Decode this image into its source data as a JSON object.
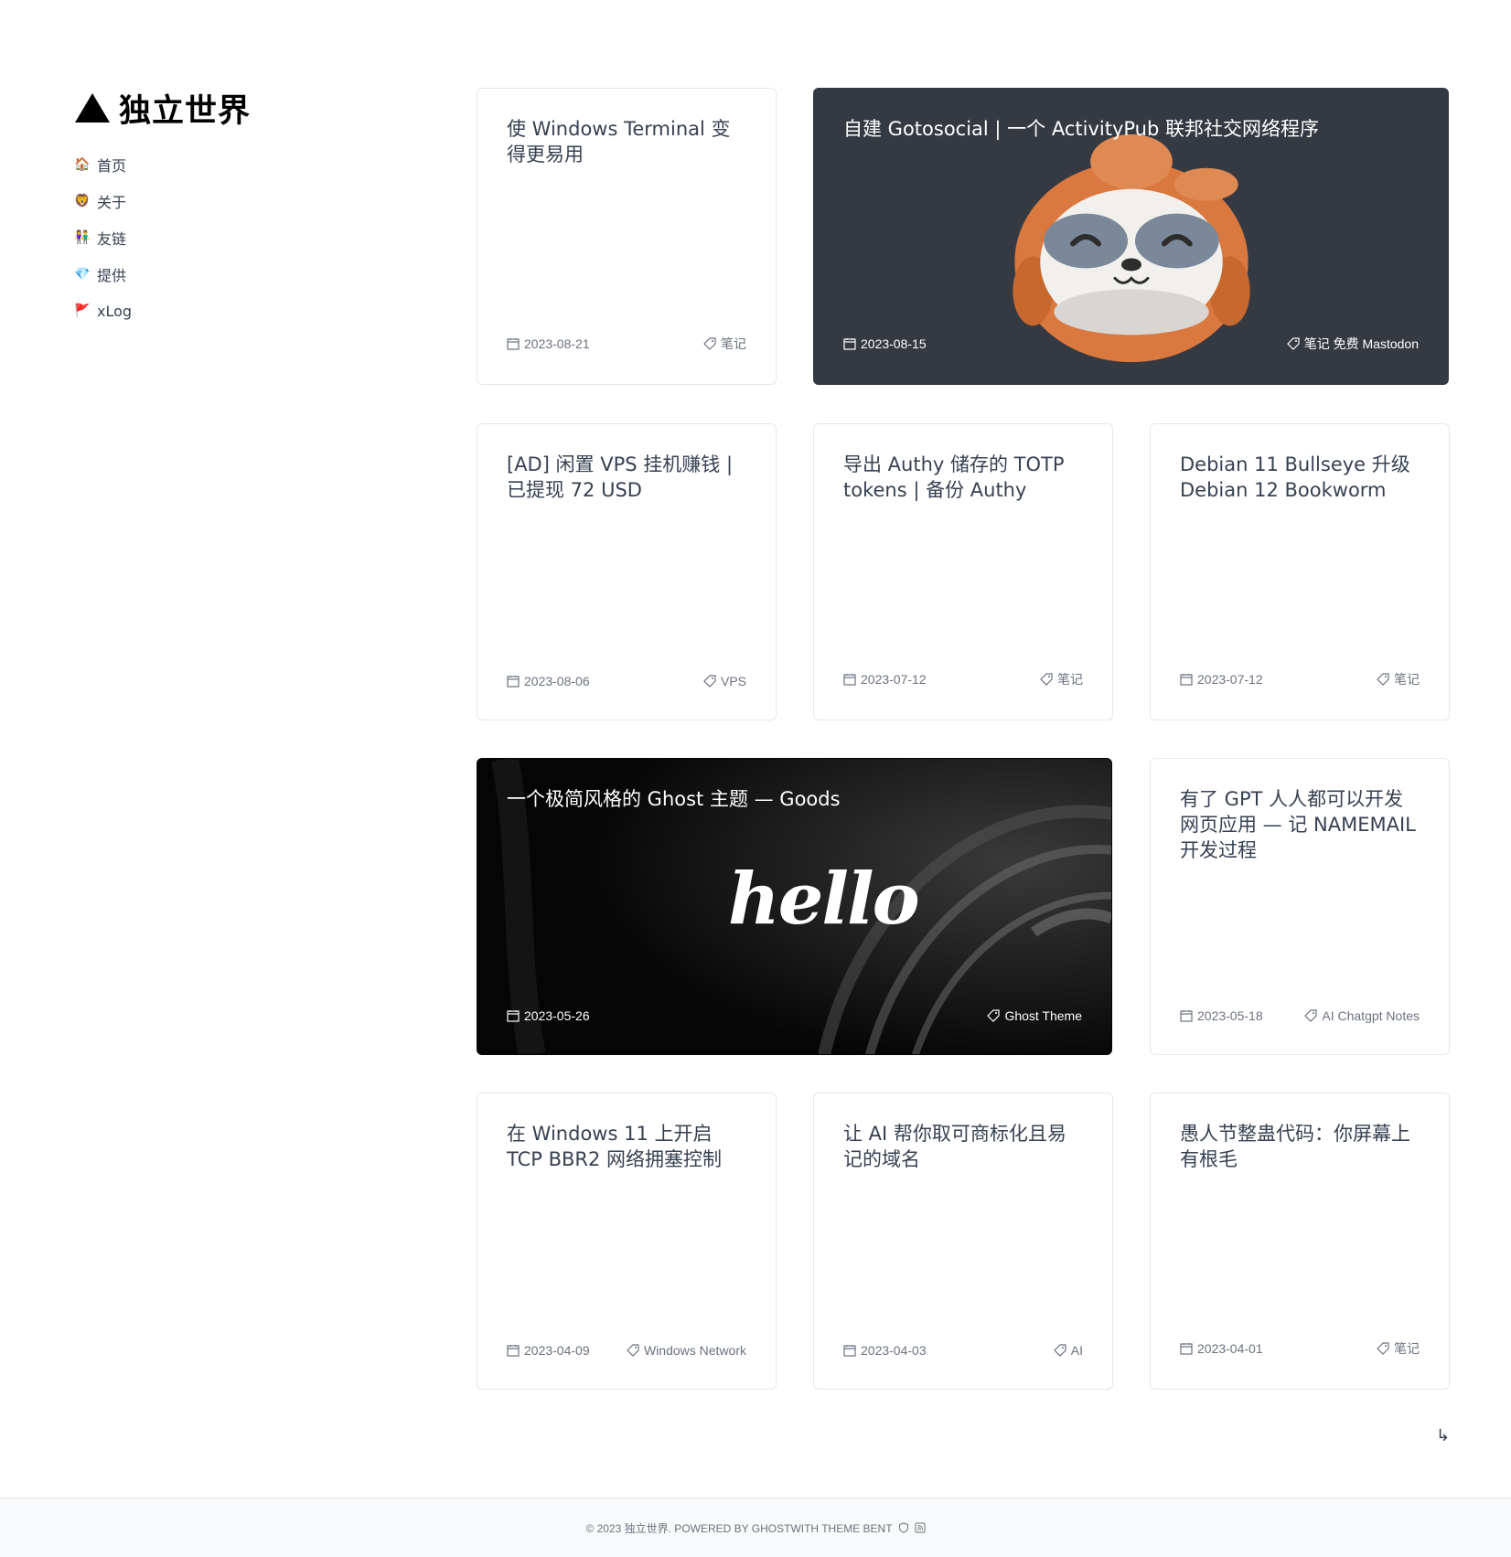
{
  "site": {
    "title": "独立世界"
  },
  "nav": [
    {
      "icon": "house-icon",
      "glyph": "🏠",
      "label": "首页"
    },
    {
      "icon": "face-icon",
      "glyph": "🦁",
      "label": "关于"
    },
    {
      "icon": "people-icon",
      "glyph": "👫",
      "label": "友链"
    },
    {
      "icon": "gem-icon",
      "glyph": "💎",
      "label": "提供"
    },
    {
      "icon": "flag-icon",
      "glyph": "🚩",
      "label": "xLog"
    }
  ],
  "posts": [
    {
      "title": "使 Windows Terminal 变得更易用",
      "date": "2023-08-21",
      "tags": "笔记"
    },
    {
      "title": "自建 Gotosocial | 一个 ActivityPub 联邦社交网络程序",
      "date": "2023-08-15",
      "tags": "笔记 免费 Mastodon"
    },
    {
      "title": "[AD] 闲置 VPS 挂机赚钱 | 已提现 72 USD",
      "date": "2023-08-06",
      "tags": "VPS"
    },
    {
      "title": "导出 Authy 储存的 TOTP tokens | 备份 Authy",
      "date": "2023-07-12",
      "tags": "笔记"
    },
    {
      "title": "Debian 11 Bullseye 升级 Debian 12 Bookworm",
      "date": "2023-07-12",
      "tags": "笔记"
    },
    {
      "title": "一个极简风格的 Ghost 主题 — Goods",
      "date": "2023-05-26",
      "tags": "Ghost Theme",
      "image_text": "hello"
    },
    {
      "title": "有了 GPT 人人都可以开发网页应用 — 记 NAMEMAIL 开发过程",
      "date": "2023-05-18",
      "tags": "AI Chatgpt Notes"
    },
    {
      "title": "在 Windows 11 上开启 TCP BBR2 网络拥塞控制",
      "date": "2023-04-09",
      "tags": "Windows Network"
    },
    {
      "title": "让 AI 帮你取可商标化且易记的域名",
      "date": "2023-04-03",
      "tags": "AI"
    },
    {
      "title": "愚人节整蛊代码：你屏幕上有根毛",
      "date": "2023-04-01",
      "tags": "笔记"
    }
  ],
  "pagination": {
    "next_glyph": "↳"
  },
  "footer": {
    "text": "© 2023 独立世界. POWERED BY GHOSTWITH THEME BENT"
  },
  "colors": {
    "dark_card": "#353a42",
    "black_card": "#050505",
    "sloth_orange": "#d9783f"
  }
}
